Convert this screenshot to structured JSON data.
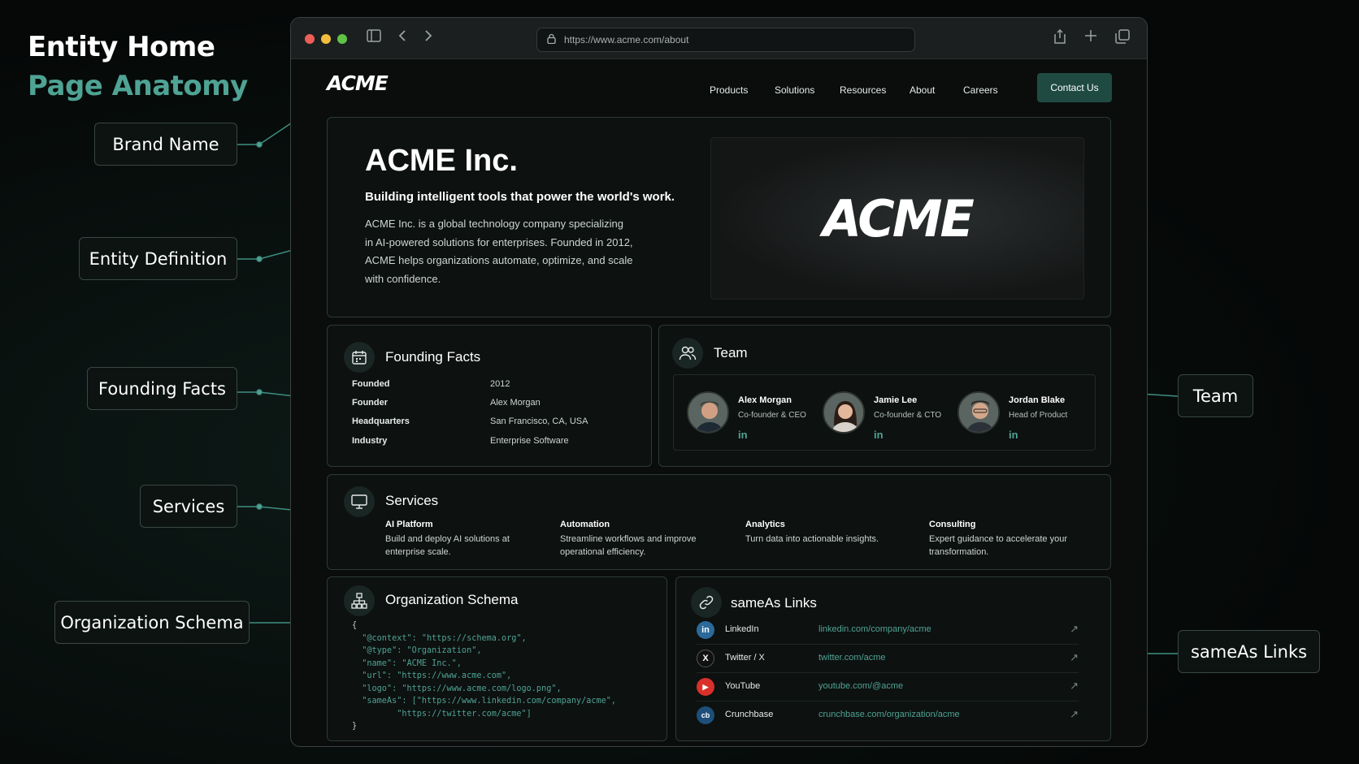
{
  "page": {
    "title_line1": "Entity Home",
    "title_line2": "Page Anatomy"
  },
  "labels": {
    "brand_name": "Brand Name",
    "entity_definition": "Entity Definition",
    "founding_facts": "Founding Facts",
    "services": "Services",
    "organization_schema": "Organization Schema",
    "team": "Team",
    "sameas_links": "sameAs Links"
  },
  "browser": {
    "url": "https://www.acme.com/about"
  },
  "nav": {
    "logo": "ACME",
    "items": [
      "Products",
      "Solutions",
      "Resources",
      "About",
      "Careers"
    ],
    "cta": "Contact Us"
  },
  "hero": {
    "heading": "ACME Inc.",
    "tagline": "Building intelligent tools that power the world's work.",
    "description": "ACME Inc. is a global technology company specializing in AI-powered solutions for enterprises. Founded in 2012, ACME helps organizations automate, optimize, and scale with confidence.",
    "image_text": "ACME"
  },
  "founding": {
    "title": "Founding Facts",
    "rows": [
      {
        "key": "Founded",
        "value": "2012"
      },
      {
        "key": "Founder",
        "value": "Alex Morgan"
      },
      {
        "key": "Headquarters",
        "value": "San Francisco, CA, USA"
      },
      {
        "key": "Industry",
        "value": "Enterprise Software"
      }
    ]
  },
  "team": {
    "title": "Team",
    "members": [
      {
        "name": "Alex Morgan",
        "role": "Co-founder & CEO",
        "link": "in"
      },
      {
        "name": "Jamie Lee",
        "role": "Co-founder & CTO",
        "link": "in"
      },
      {
        "name": "Jordan Blake",
        "role": "Head of Product",
        "link": "in"
      }
    ]
  },
  "services": {
    "title": "Services",
    "items": [
      {
        "name": "AI Platform",
        "desc": "Build and deploy AI solutions at enterprise scale."
      },
      {
        "name": "Automation",
        "desc": "Streamline workflows and improve operational efficiency."
      },
      {
        "name": "Analytics",
        "desc": "Turn data into actionable insights."
      },
      {
        "name": "Consulting",
        "desc": "Expert guidance to accelerate your transformation."
      }
    ]
  },
  "schema": {
    "title": "Organization Schema",
    "lines": [
      "{",
      "  \"@context\": \"https://schema.org\",",
      "  \"@type\": \"Organization\",",
      "  \"name\": \"ACME Inc.\",",
      "  \"url\": \"https://www.acme.com\",",
      "  \"logo\": \"https://www.acme.com/logo.png\",",
      "  \"sameAs\": [\"https://www.linkedin.com/company/acme\",",
      "         \"https://twitter.com/acme\"]",
      "}"
    ]
  },
  "sameas": {
    "title": "sameAs Links",
    "items": [
      {
        "name": "LinkedIn",
        "url": "linkedin.com/company/acme",
        "icon": "linkedin-icon",
        "glyph": "in"
      },
      {
        "name": "Twitter / X",
        "url": "twitter.com/acme",
        "icon": "x-icon",
        "glyph": "X"
      },
      {
        "name": "YouTube",
        "url": "youtube.com/@acme",
        "icon": "youtube-icon",
        "glyph": "▶"
      },
      {
        "name": "Crunchbase",
        "url": "crunchbase.com/organization/acme",
        "icon": "crunchbase-icon",
        "glyph": "cb"
      }
    ]
  },
  "colors": {
    "accent": "#4fa394",
    "cta_bg": "#1f4a42",
    "background": "#050807"
  }
}
